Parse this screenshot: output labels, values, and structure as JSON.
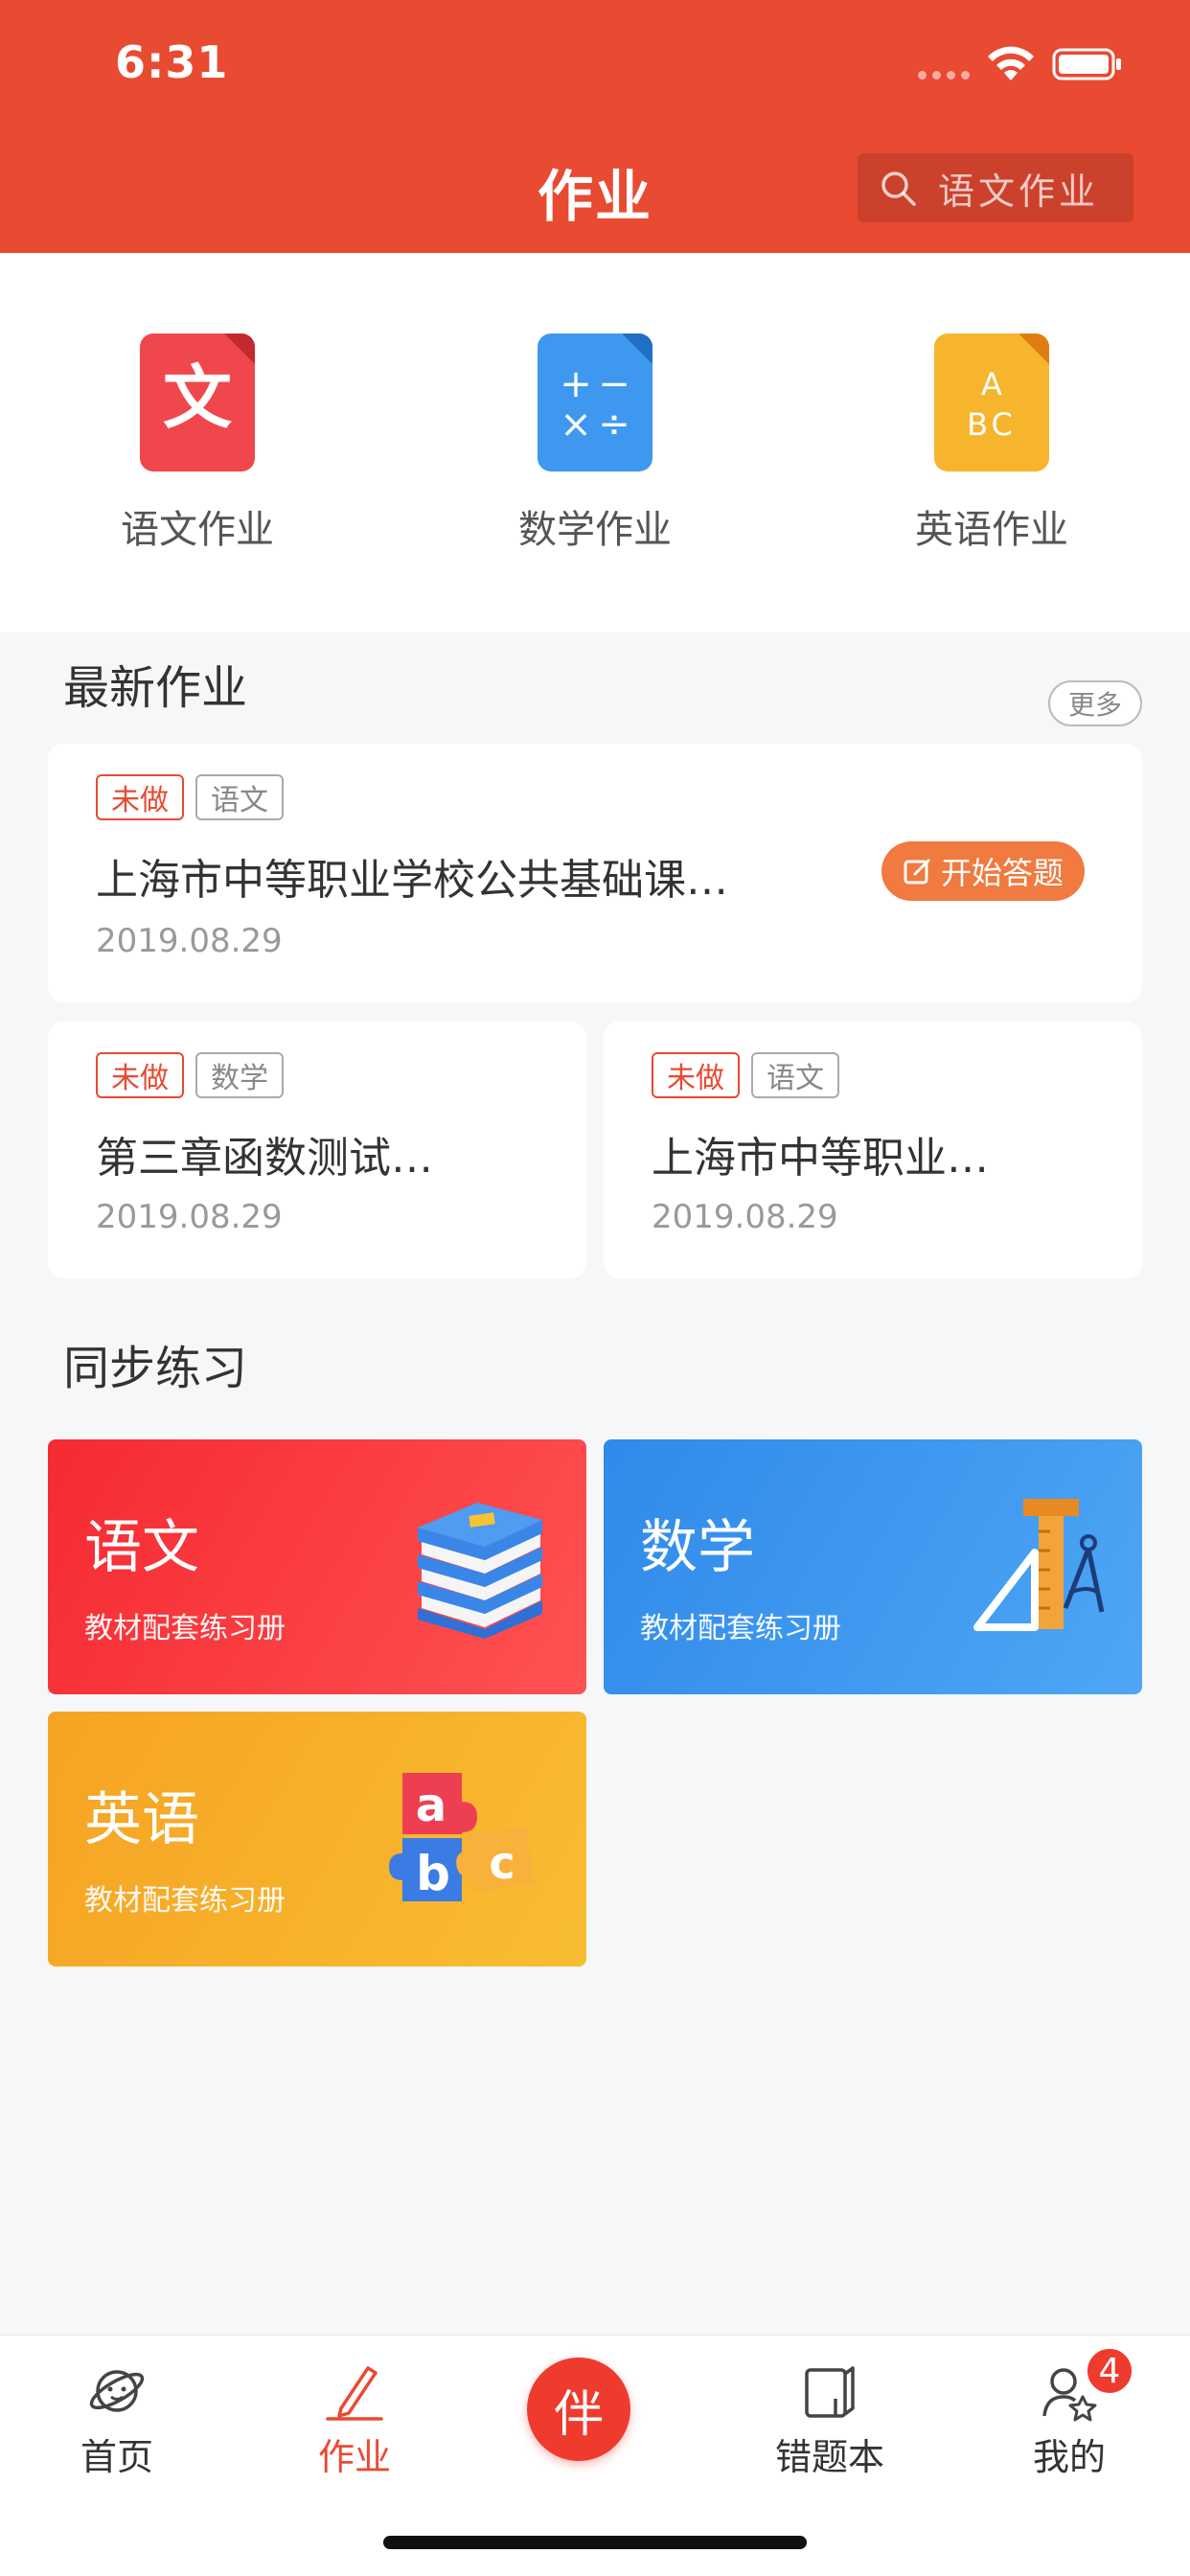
{
  "status_bar": {
    "time": "6:31"
  },
  "header": {
    "title": "作业",
    "search_placeholder": "语文作业"
  },
  "categories": [
    {
      "label": "语文作业",
      "icon": "chinese-doc-icon",
      "glyph": "文",
      "color": "#f0474d"
    },
    {
      "label": "数学作业",
      "icon": "math-doc-icon",
      "glyph": "+ −\n× ÷",
      "color": "#3e98ef"
    },
    {
      "label": "英语作业",
      "icon": "english-doc-icon",
      "glyph": "A\nBC",
      "color": "#f7b52e"
    }
  ],
  "latest": {
    "section_title": "最新作业",
    "more_label": "更多",
    "items": [
      {
        "status": "未做",
        "subject": "语文",
        "title": "上海市中等职业学校公共基础课…",
        "date": "2019.08.29",
        "action": "开始答题"
      },
      {
        "status": "未做",
        "subject": "数学",
        "title": "第三章函数测试…",
        "date": "2019.08.29"
      },
      {
        "status": "未做",
        "subject": "语文",
        "title": "上海市中等职业…",
        "date": "2019.08.29"
      }
    ]
  },
  "practice": {
    "section_title": "同步练习",
    "tiles": [
      {
        "title": "语文",
        "subtitle": "教材配套练习册",
        "icon": "books-icon"
      },
      {
        "title": "数学",
        "subtitle": "教材配套练习册",
        "icon": "ruler-compass-icon"
      },
      {
        "title": "英语",
        "subtitle": "教材配套练习册",
        "icon": "abc-puzzle-icon"
      }
    ]
  },
  "bottom_nav": {
    "items": [
      {
        "label": "首页",
        "icon": "planet-icon"
      },
      {
        "label": "作业",
        "icon": "pencil-icon",
        "active": true
      },
      {
        "label": "伴",
        "icon": "companion-button"
      },
      {
        "label": "错题本",
        "icon": "notebook-icon"
      },
      {
        "label": "我的",
        "icon": "profile-icon",
        "badge": "4"
      }
    ]
  },
  "colors": {
    "brand": "#e84a32",
    "accent_orange": "#f07a3f"
  }
}
